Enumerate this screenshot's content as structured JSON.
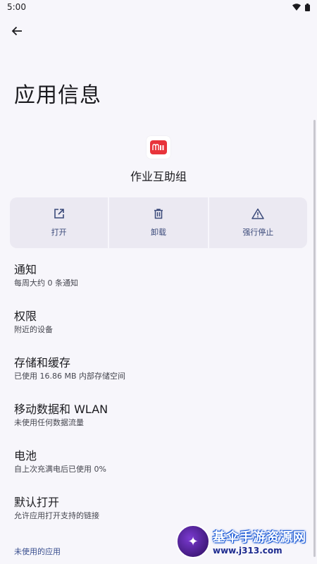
{
  "status_bar": {
    "time": "5:00"
  },
  "page_title": "应用信息",
  "app": {
    "name": "作业互助组",
    "icon_text": "m"
  },
  "actions": [
    {
      "label": "打开",
      "icon": "open-external-icon"
    },
    {
      "label": "卸载",
      "icon": "trash-icon"
    },
    {
      "label": "强行停止",
      "icon": "warning-icon"
    }
  ],
  "items": [
    {
      "title": "通知",
      "subtitle": "每周大约 0 条通知"
    },
    {
      "title": "权限",
      "subtitle": "附近的设备"
    },
    {
      "title": "存储和缓存",
      "subtitle": "已使用 16.86 MB 内部存储空间"
    },
    {
      "title": "移动数据和 WLAN",
      "subtitle": "未使用任何数据流量"
    },
    {
      "title": "电池",
      "subtitle": "自上次充满电后已使用 0%"
    },
    {
      "title": "默认打开",
      "subtitle": "允许应用打开支持的链接"
    }
  ],
  "footer_link": "未使用的应用",
  "watermark": {
    "name": "基伞手游资源网",
    "url": "www.j313.com"
  },
  "colors": {
    "accent": "#3b4a7a",
    "action_bg": "#ebe9f2",
    "background": "#f7f6fb",
    "icon_red": "#e8343b"
  }
}
